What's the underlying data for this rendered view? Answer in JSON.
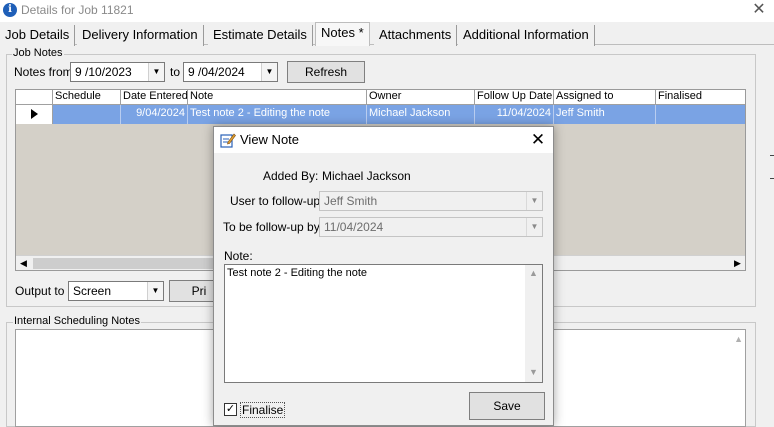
{
  "window": {
    "title": "Details for Job 11821",
    "app_icon": "info-icon",
    "close_glyph": "✕"
  },
  "tabs": [
    {
      "label": "Job Details"
    },
    {
      "label": "Delivery Information"
    },
    {
      "label": "Estimate Details"
    },
    {
      "label": "Notes *",
      "active": true
    },
    {
      "label": "Attachments"
    },
    {
      "label": "Additional Information"
    }
  ],
  "job_notes": {
    "group_label": "Job Notes",
    "notes_from_label": "Notes from",
    "from_date": "9 /10/2023",
    "to_label": "to",
    "to_date": "9 /04/2024",
    "refresh_label": "Refresh",
    "columns": [
      "Schedule",
      "Date Entered",
      "Note",
      "Owner",
      "Follow Up Date",
      "Assigned to",
      "Finalised"
    ],
    "rows": [
      {
        "schedule": "",
        "date_entered": "9/04/2024",
        "note": "Test note 2 - Editing the note",
        "owner": "Michael Jackson",
        "follow_up_date": "11/04/2024",
        "assigned_to": "Jeff Smith",
        "finalised": ""
      }
    ],
    "output_to_label": "Output to",
    "output_to_value": "Screen",
    "print_label": "Pri"
  },
  "internal_scheduling": {
    "group_label": "Internal Scheduling Notes"
  },
  "dialog": {
    "title": "View Note",
    "close_glyph": "✕",
    "added_by_label": "Added By:",
    "added_by_value": "Michael Jackson",
    "user_follow_label": "User to follow-up:",
    "user_follow_value": "Jeff Smith",
    "follow_by_label": "To be follow-up by:",
    "follow_by_value": "11/04/2024",
    "note_label": "Note:",
    "note_text": "Test note 2 - Editing the note",
    "finalise_label": "Finalise",
    "finalise_checked": true,
    "save_label": "Save"
  },
  "colors": {
    "selection": "#7aa3e4",
    "accent": "#1f5fb8"
  }
}
